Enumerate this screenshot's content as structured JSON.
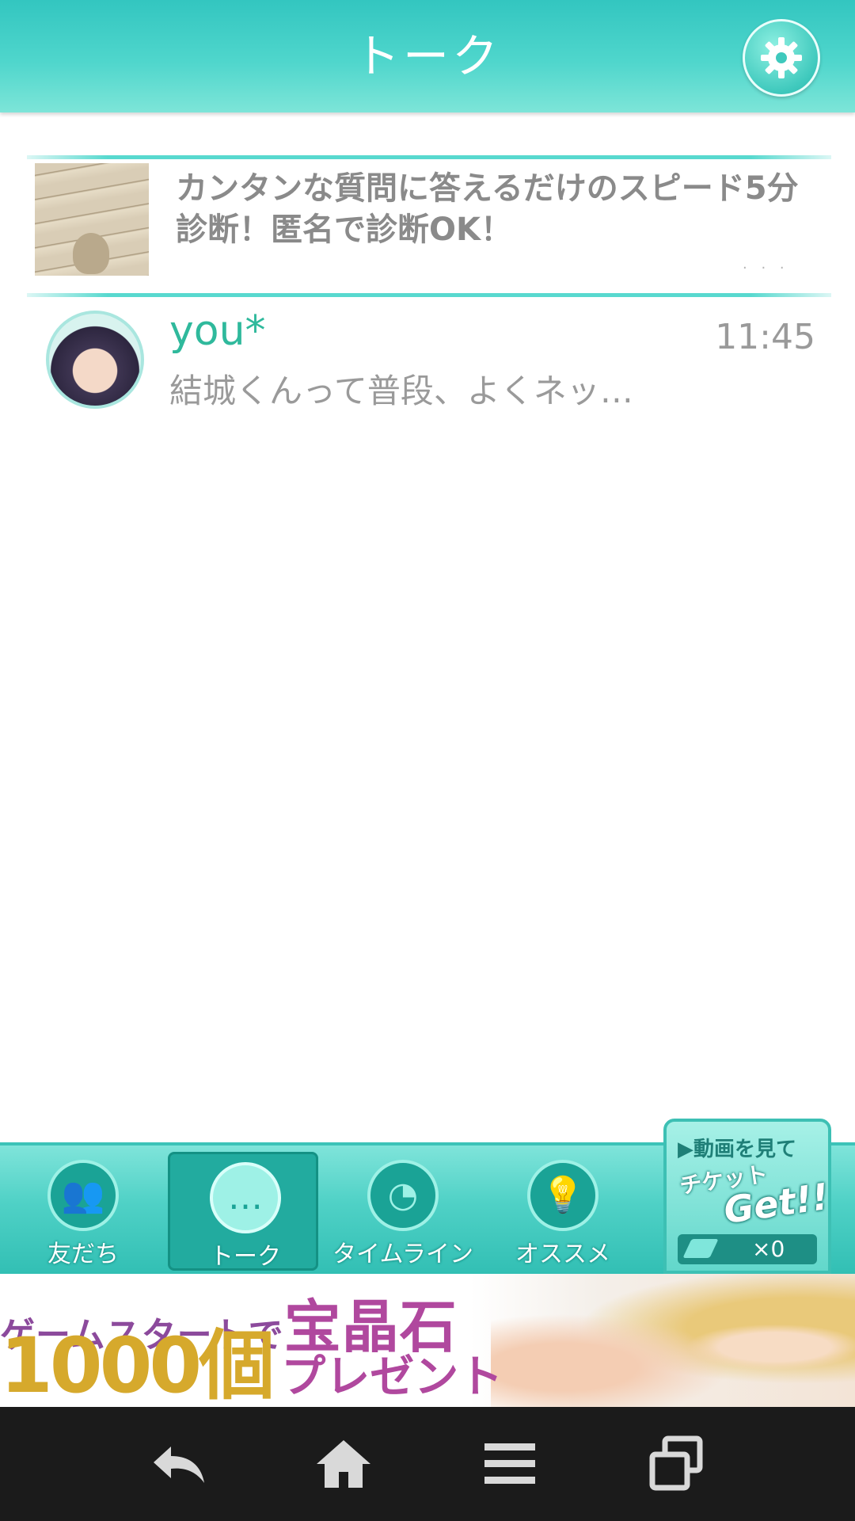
{
  "header": {
    "title": "トーク"
  },
  "ad": {
    "text": "カンタンな質問に答えるだけのスピード5分診断！匿名で診断OK！"
  },
  "chats": [
    {
      "name": "you*",
      "time": "11:45",
      "preview": "結城くんって普段、よくネッ…"
    }
  ],
  "tabs": [
    {
      "label": "友だち",
      "icon": "friends-icon"
    },
    {
      "label": "トーク",
      "icon": "chat-bubble-icon"
    },
    {
      "label": "タイムライン",
      "icon": "clock-icon"
    },
    {
      "label": "オススメ",
      "icon": "lightbulb-icon"
    }
  ],
  "ticket": {
    "line1": "動画を見て",
    "line2": "チケット",
    "get": "Get!!",
    "count": "×0"
  },
  "banner": {
    "line1_prefix": "ゲームスタートで",
    "line1_big": "宝晶石",
    "number": "1000個",
    "present": "プレゼント"
  },
  "navbar": {
    "buttons": [
      "back-icon",
      "home-icon",
      "menu-icon",
      "recent-apps-icon"
    ]
  },
  "colors": {
    "accent": "#4fd6cc",
    "name": "#2fb99c",
    "nav_background": "#1b1b1b"
  }
}
